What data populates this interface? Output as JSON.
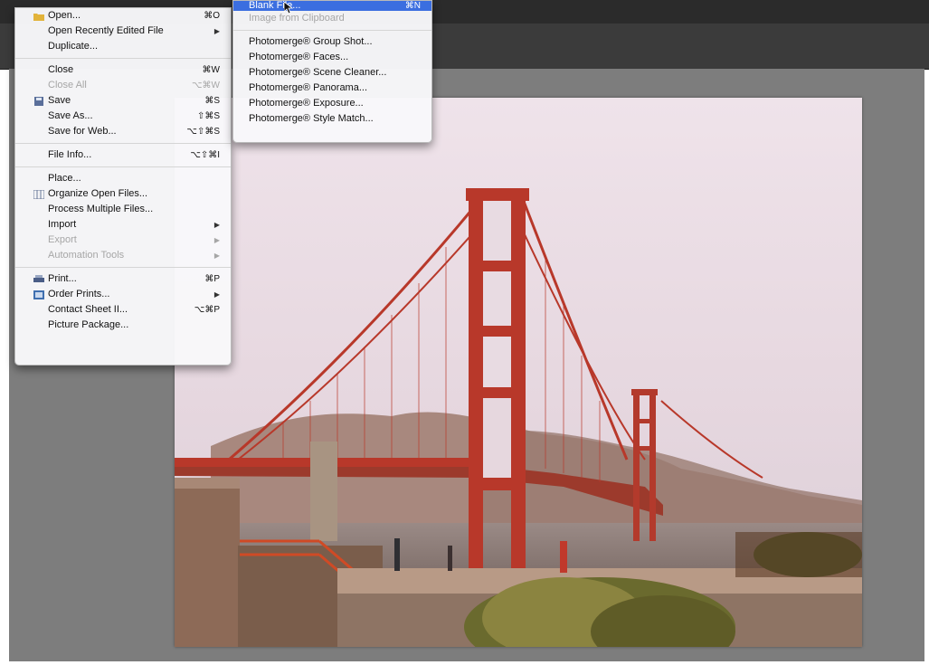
{
  "file_menu": {
    "groups": [
      [
        {
          "label": "Open...",
          "shortcut": "⌘O",
          "icon": "folder-icon"
        },
        {
          "label": "Open Recently Edited File",
          "submenu": true
        },
        {
          "label": "Duplicate..."
        }
      ],
      [
        {
          "label": "Close",
          "shortcut": "⌘W"
        },
        {
          "label": "Close All",
          "shortcut": "⌥⌘W",
          "disabled": true
        },
        {
          "label": "Save",
          "shortcut": "⌘S",
          "icon": "save-icon"
        },
        {
          "label": "Save As...",
          "shortcut": "⇧⌘S"
        },
        {
          "label": "Save for Web...",
          "shortcut": "⌥⇧⌘S"
        }
      ],
      [
        {
          "label": "File Info...",
          "shortcut": "⌥⇧⌘I"
        }
      ],
      [
        {
          "label": "Place..."
        },
        {
          "label": "Organize Open Files...",
          "icon": "organize-icon"
        },
        {
          "label": "Process Multiple Files..."
        },
        {
          "label": "Import",
          "submenu": true
        },
        {
          "label": "Export",
          "submenu": true,
          "disabled": true
        },
        {
          "label": "Automation Tools",
          "submenu": true,
          "disabled": true
        }
      ],
      [
        {
          "label": "Print...",
          "shortcut": "⌘P",
          "icon": "print-icon"
        },
        {
          "label": "Order Prints...",
          "submenu": true,
          "icon": "order-prints-icon"
        },
        {
          "label": "Contact Sheet II...",
          "shortcut": "⌥⌘P"
        },
        {
          "label": "Picture Package..."
        }
      ]
    ]
  },
  "new_submenu": {
    "top_items": [
      {
        "label": "Blank File...",
        "shortcut": "⌘N",
        "highlighted": true
      },
      {
        "label": "Image from Clipboard",
        "disabled": true
      }
    ],
    "photomerge_items": [
      {
        "label": "Photomerge® Group Shot..."
      },
      {
        "label": "Photomerge® Faces..."
      },
      {
        "label": "Photomerge® Scene Cleaner..."
      },
      {
        "label": "Photomerge® Panorama..."
      },
      {
        "label": "Photomerge® Exposure..."
      },
      {
        "label": "Photomerge® Style Match..."
      }
    ]
  },
  "colors": {
    "menu_highlight": "#3b6ee0",
    "canvas_background": "#7d7d7d",
    "bridge_red": "#b8382a"
  }
}
